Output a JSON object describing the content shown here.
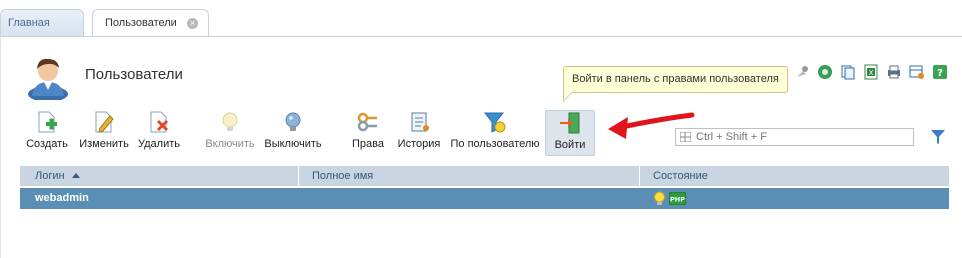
{
  "tabs": [
    {
      "label": "Главная"
    },
    {
      "label": "Пользователи"
    }
  ],
  "page": {
    "title": "Пользователи"
  },
  "tooltip": {
    "text": "Войти в панель с правами пользователя"
  },
  "toolbar": {
    "create": "Создать",
    "edit": "Изменить",
    "delete": "Удалить",
    "enable": "Включить",
    "disable": "Выключить",
    "rights": "Права",
    "history": "История",
    "by_user": "По пользователю",
    "login": "Войти"
  },
  "search": {
    "placeholder": "Ctrl + Shift + F",
    "value": ""
  },
  "table": {
    "columns": [
      "Логин",
      "Полное имя",
      "Состояние"
    ],
    "rows": [
      {
        "login": "webadmin",
        "full_name": "",
        "status_icons": [
          "bulb-on-icon",
          "php-icon"
        ]
      }
    ]
  },
  "colors": {
    "header_bg": "#c9d6e2",
    "selected_row": "#5b8eb5",
    "tooltip_bg": "#ffffd8",
    "arrow": "#e0141b"
  }
}
